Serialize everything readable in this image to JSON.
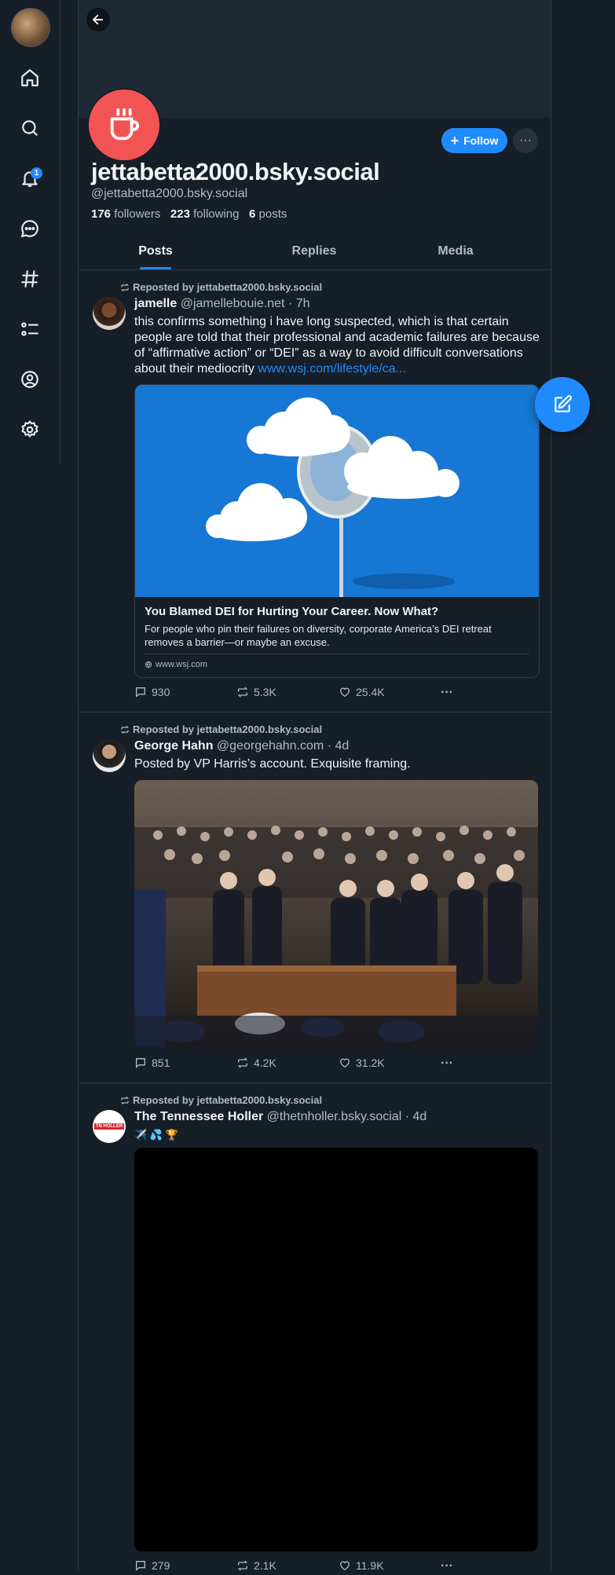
{
  "nav": {
    "items": [
      {
        "name": "home-icon"
      },
      {
        "name": "search-icon"
      },
      {
        "name": "notifications-icon"
      },
      {
        "name": "chat-icon"
      },
      {
        "name": "feeds-icon"
      },
      {
        "name": "lists-icon"
      },
      {
        "name": "profile-icon"
      },
      {
        "name": "settings-icon"
      }
    ],
    "notification_count": "1"
  },
  "profile": {
    "display_name": "jettabetta2000.bsky.social",
    "handle": "@jettabetta2000.bsky.social",
    "followers_count": "176",
    "followers_label": "followers",
    "following_count": "223",
    "following_label": "following",
    "posts_count": "6",
    "posts_label": "posts",
    "follow_label": "Follow",
    "avatar_color": "#f25454"
  },
  "tabs": [
    {
      "label": "Posts",
      "active": true
    },
    {
      "label": "Replies",
      "active": false
    },
    {
      "label": "Media",
      "active": false
    }
  ],
  "posts": [
    {
      "repost_label": "Reposted by jettabetta2000.bsky.social",
      "author_name": "jamelle",
      "author_handle": "@jamellebouie.net",
      "time": "· 7h",
      "text": "this confirms something i have long suspected, which is that certain people are told that their professional and academic failures are because of “affirmative action” or “DEI” as a way to avoid difficult conversations about their mediocrity ",
      "link_text": "www.wsj.com/lifestyle/ca...",
      "card": {
        "title": "You Blamed DEI for Hurting Your Career. Now What?",
        "description": "For people who pin their failures on diversity, corporate America’s DEI retreat removes a barrier—or maybe an excuse.",
        "domain": "www.wsj.com"
      },
      "replies": "930",
      "reposts": "5.3K",
      "likes": "25.4K"
    },
    {
      "repost_label": "Reposted by jettabetta2000.bsky.social",
      "author_name": "George Hahn",
      "author_handle": "@georgehahn.com",
      "time": "· 4d",
      "text": "Posted by VP Harris’s account. Exquisite framing.",
      "replies": "851",
      "reposts": "4.2K",
      "likes": "31.2K"
    },
    {
      "repost_label": "Reposted by jettabetta2000.bsky.social",
      "author_name": "The Tennessee Holler",
      "author_handle": "@thetnholler.bsky.social",
      "time": "· 4d",
      "text": "✈️ 💦 🏆",
      "avatar_label": "TN HOLLER",
      "replies": "279",
      "reposts": "2.1K",
      "likes": "11.9K"
    }
  ],
  "colors": {
    "accent": "#208bfe",
    "background": "#161e27",
    "border": "#2e3b4a",
    "muted": "#aebbc9"
  }
}
